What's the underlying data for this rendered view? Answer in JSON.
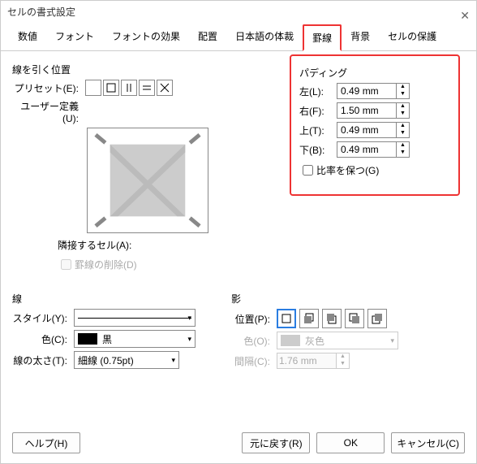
{
  "window_title": "セルの書式設定",
  "tabs": [
    "数値",
    "フォント",
    "フォントの効果",
    "配置",
    "日本語の体裁",
    "罫線",
    "背景",
    "セルの保護"
  ],
  "active_tab": 5,
  "position": {
    "title": "線を引く位置",
    "preset_label": "プリセット(E):",
    "userdef_label": "ユーザー定義(U):",
    "adjacent_label": "隣接するセル(A):",
    "remove_label": "罫線の削除(D)"
  },
  "padding": {
    "title": "パディング",
    "left_label": "左(L):",
    "left_val": "0.49 mm",
    "right_label": "右(F):",
    "right_val": "1.50 mm",
    "top_label": "上(T):",
    "top_val": "0.49 mm",
    "bottom_label": "下(B):",
    "bottom_val": "0.49 mm",
    "keep_ratio": "比率を保つ(G)"
  },
  "line": {
    "title": "線",
    "style_label": "スタイル(Y):",
    "color_label": "色(C):",
    "color_val": "黒",
    "width_label": "線の太さ(T):",
    "width_val": "細線 (0.75pt)"
  },
  "shadow": {
    "title": "影",
    "pos_label": "位置(P):",
    "color_label": "色(O):",
    "color_val": "灰色",
    "gap_label": "間隔(C):",
    "gap_val": "1.76 mm"
  },
  "buttons": {
    "help": "ヘルプ(H)",
    "reset": "元に戻す(R)",
    "ok": "OK",
    "cancel": "キャンセル(C)"
  }
}
